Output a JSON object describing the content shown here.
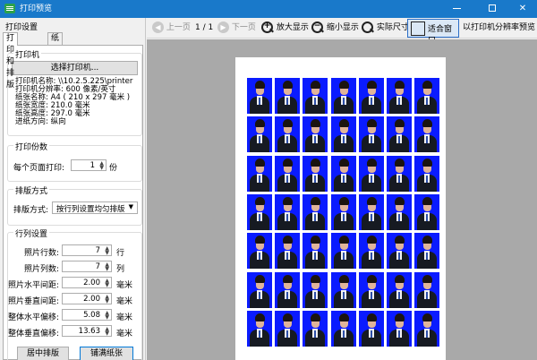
{
  "window": {
    "title": "打印预览"
  },
  "panel": {
    "title": "打印设置"
  },
  "tabs": [
    {
      "label": "打印和排版",
      "active": true
    },
    {
      "label": "纸张和边框",
      "active": false
    }
  ],
  "printer_group": {
    "title": "打印机",
    "select_button": "选择打印机...",
    "info": [
      "打印机名称: \\\\10.2.5.225\\printer",
      "打印机分辨率: 600 像素/英寸",
      "纸张名称: A4 ( 210 x 297 毫米 )",
      "纸张宽度: 210.0 毫米",
      "纸张高度: 297.0 毫米",
      "进纸方向: 纵向"
    ]
  },
  "copies_group": {
    "title": "打印份数",
    "label": "每个页面打印:",
    "value": "1",
    "unit": "份"
  },
  "layout_group": {
    "title": "排版方式",
    "label": "排版方式:",
    "value": "按行列设置均匀排版"
  },
  "grid_group": {
    "title": "行列设置",
    "fields": [
      {
        "label": "照片行数:",
        "value": "7",
        "unit": "行"
      },
      {
        "label": "照片列数:",
        "value": "7",
        "unit": "列"
      },
      {
        "label": "照片水平间距:",
        "value": "2.00",
        "unit": "毫米"
      },
      {
        "label": "照片垂直间距:",
        "value": "2.00",
        "unit": "毫米"
      },
      {
        "label": "整体水平偏移:",
        "value": "5.08",
        "unit": "毫米"
      },
      {
        "label": "整体垂直偏移:",
        "value": "13.63",
        "unit": "毫米"
      }
    ],
    "center_button": "居中排版",
    "fill_button": "铺满纸张"
  },
  "toolbar": {
    "prev": "上一页",
    "page": "1 / 1",
    "next": "下一页",
    "zoom_in": "放大显示",
    "zoom_out": "缩小显示",
    "actual": "实际尺寸",
    "fit": "适合窗口",
    "printer_res": "以打印机分辨率预览"
  },
  "preview": {
    "rows": 7,
    "cols": 7,
    "background": "#0a1bff"
  }
}
